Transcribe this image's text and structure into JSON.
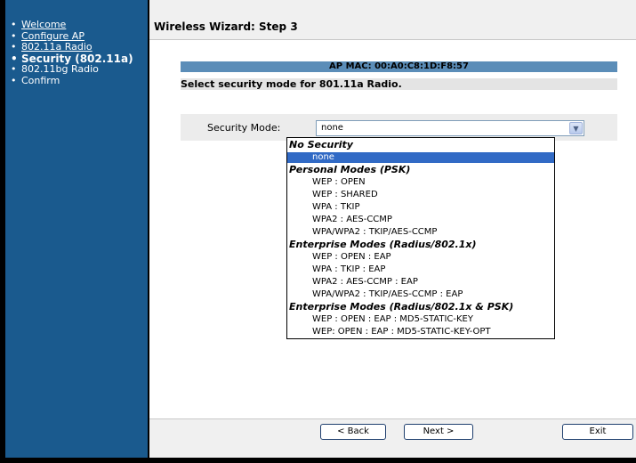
{
  "sidebar": {
    "items": [
      {
        "label": "Welcome",
        "link": true,
        "active": false
      },
      {
        "label": "Configure AP",
        "link": true,
        "active": false
      },
      {
        "label": "802.11a Radio",
        "link": true,
        "active": false
      },
      {
        "label": "Security (802.11a)",
        "link": false,
        "active": true
      },
      {
        "label": "802.11bg Radio",
        "link": false,
        "active": false
      },
      {
        "label": "Confirm",
        "link": false,
        "active": false
      }
    ]
  },
  "header": {
    "title": "Wireless Wizard: Step 3"
  },
  "main": {
    "mac_label": "AP MAC: 00:A0:C8:1D:F8:57",
    "select_heading": "Select security mode for 801.11a Radio.",
    "security_mode_label": "Security Mode:",
    "security_mode_value": "none"
  },
  "dropdown": {
    "options": [
      {
        "text": "No Security",
        "type": "group"
      },
      {
        "text": "none",
        "type": "item",
        "selected": true
      },
      {
        "text": "Personal Modes (PSK)",
        "type": "group"
      },
      {
        "text": "WEP : OPEN",
        "type": "item"
      },
      {
        "text": "WEP : SHARED",
        "type": "item"
      },
      {
        "text": "WPA : TKIP",
        "type": "item"
      },
      {
        "text": "WPA2 : AES-CCMP",
        "type": "item"
      },
      {
        "text": "WPA/WPA2 : TKIP/AES-CCMP",
        "type": "item"
      },
      {
        "text": "Enterprise Modes (Radius/802.1x)",
        "type": "group"
      },
      {
        "text": "WEP : OPEN : EAP",
        "type": "item"
      },
      {
        "text": "WPA : TKIP : EAP",
        "type": "item"
      },
      {
        "text": "WPA2 : AES-CCMP : EAP",
        "type": "item"
      },
      {
        "text": "WPA/WPA2 : TKIP/AES-CCMP : EAP",
        "type": "item"
      },
      {
        "text": "Enterprise Modes (Radius/802.1x & PSK)",
        "type": "group"
      },
      {
        "text": "WEP : OPEN : EAP : MD5-STATIC-KEY",
        "type": "item"
      },
      {
        "text": "WEP: OPEN : EAP : MD5-STATIC-KEY-OPT",
        "type": "item"
      }
    ]
  },
  "footer": {
    "back_label": "< Back",
    "next_label": "Next >",
    "exit_label": "Exit"
  },
  "colors": {
    "sidebar_bg": "#1a5a8e",
    "mac_bar_bg": "#5b8db8",
    "selected_bg": "#316ac5"
  }
}
